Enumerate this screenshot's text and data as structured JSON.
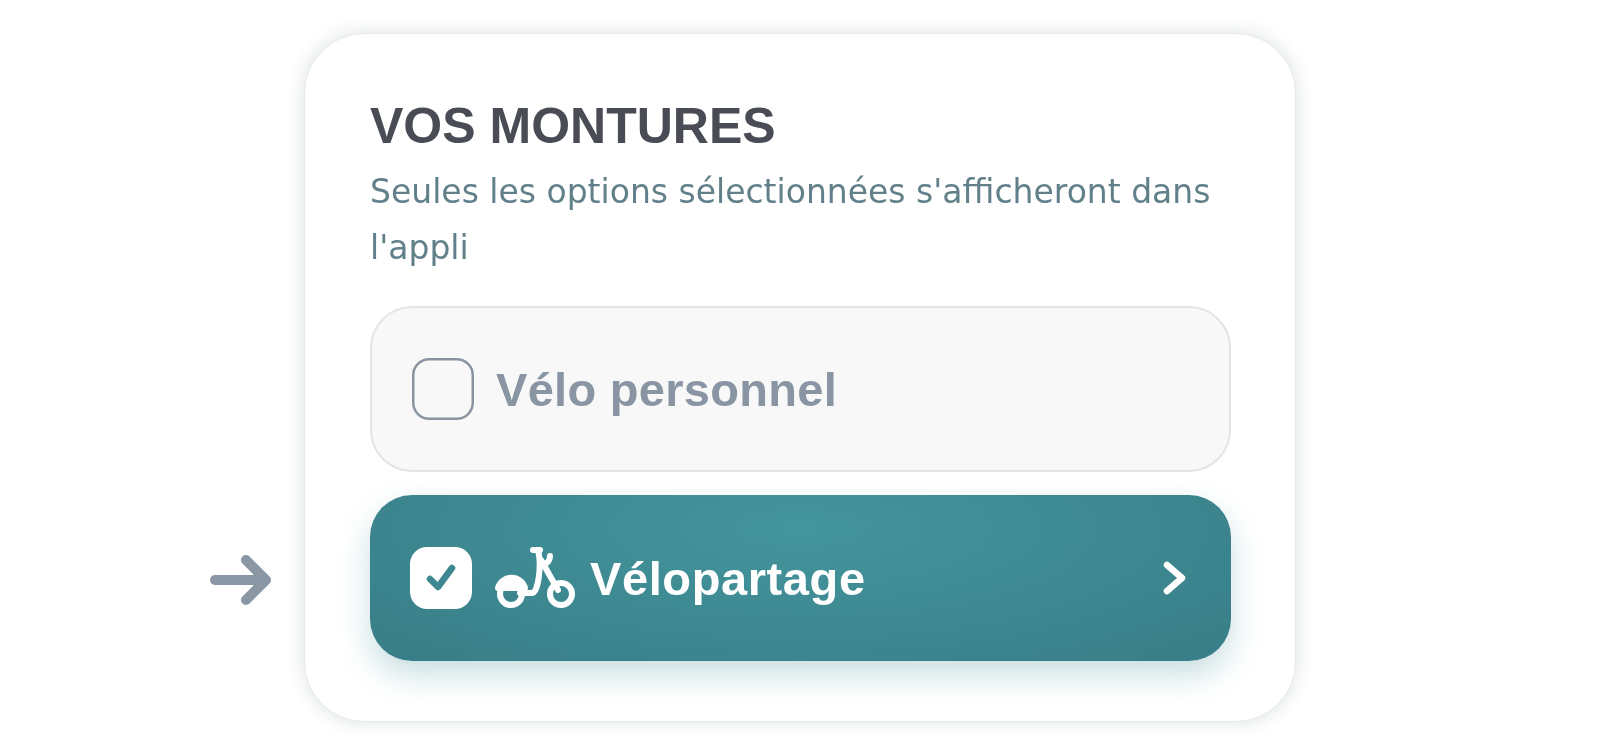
{
  "card": {
    "title": "VOS MONTURES",
    "subtitle": "Seules les options sélectionnées s'afficheront dans l'appli"
  },
  "options": [
    {
      "kind": "personal",
      "label": "Vélo personnel",
      "checked": false,
      "pointed_at": false
    },
    {
      "kind": "bikeshare",
      "label": "Vélopartage",
      "checked": true,
      "pointed_at": true
    }
  ]
}
